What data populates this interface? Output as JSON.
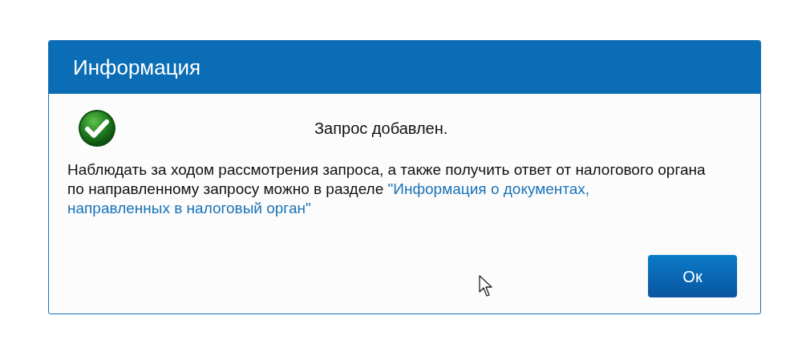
{
  "dialog": {
    "title": "Информация",
    "kind": "success",
    "headline": "Запрос добавлен.",
    "message": "Наблюдать за ходом рассмотрения запроса, а также получить ответ от налогового органа по направленному запросу можно в разделе ",
    "link_lines": [
      "\"Информация о документах,",
      "направленных в налоговый орган\""
    ],
    "buttons": [
      "Ок"
    ]
  }
}
